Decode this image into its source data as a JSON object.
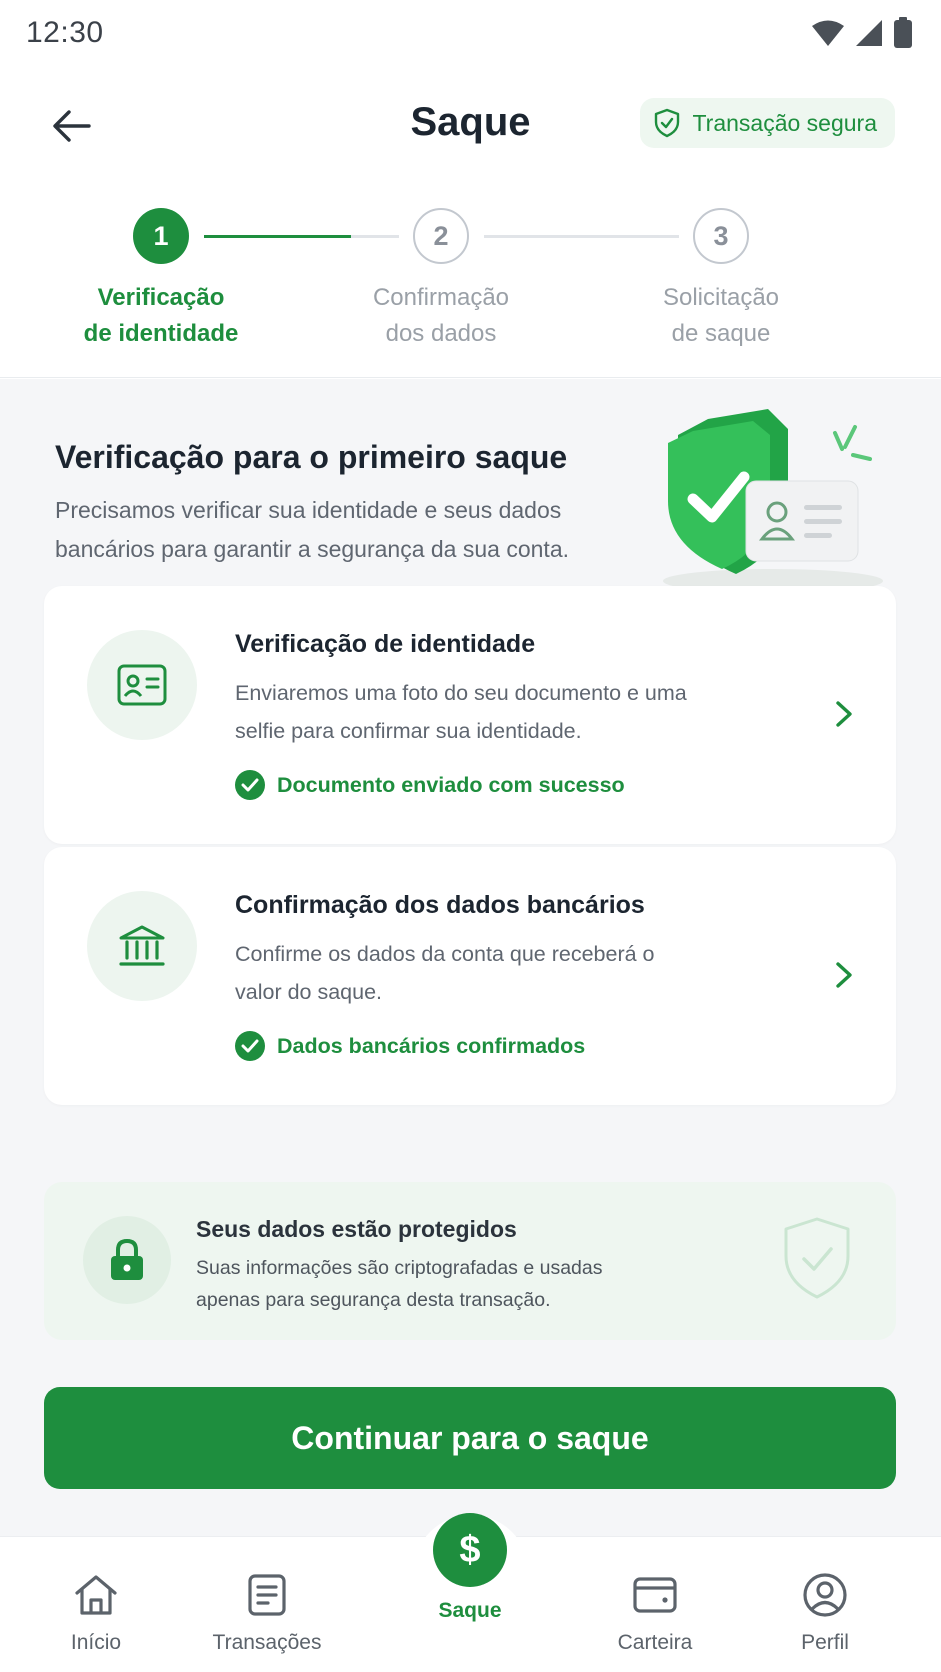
{
  "status_bar": {
    "time": "12:30"
  },
  "header": {
    "title": "Saque",
    "secure_badge": "Transação segura"
  },
  "stepper": {
    "steps": [
      {
        "number": "1",
        "label": "Verificação\nde identidade",
        "state": "active"
      },
      {
        "number": "2",
        "label": "Confirmação\ndos dados",
        "state": "pending"
      },
      {
        "number": "3",
        "label": "Solicitação\nde saque",
        "state": "pending"
      }
    ]
  },
  "intro": {
    "title": "Verificação para o primeiro saque",
    "description": "Precisamos verificar sua identidade e seus dados bancários para garantir a segurança da sua conta."
  },
  "cards": [
    {
      "icon": "id-card-icon",
      "title": "Verificação de identidade",
      "description": "Enviaremos uma foto do seu documento e uma selfie para confirmar sua identidade.",
      "status": "Documento enviado com sucesso"
    },
    {
      "icon": "bank-icon",
      "title": "Confirmação dos dados bancários",
      "description": "Confirme os dados da conta que receberá o valor do saque.",
      "status": "Dados bancários confirmados"
    }
  ],
  "protection": {
    "title": "Seus dados estão protegidos",
    "description": "Suas informações são criptografadas e usadas apenas para segurança desta transação."
  },
  "cta": {
    "label": "Continuar para o saque"
  },
  "bottom_nav": {
    "items": [
      {
        "label": "Início",
        "icon": "home-icon",
        "active": false
      },
      {
        "label": "Transações",
        "icon": "receipt-icon",
        "active": false
      },
      {
        "label": "Saque",
        "icon": "dollar-icon",
        "active": true
      },
      {
        "label": "Carteira",
        "icon": "wallet-icon",
        "active": false
      },
      {
        "label": "Perfil",
        "icon": "profile-icon",
        "active": false
      }
    ],
    "saque_symbol": "$"
  },
  "colors": {
    "accent": "#1e8e3e",
    "accent_soft": "#edf5ef",
    "background": "#f5f6f8",
    "text_primary": "#1c2530",
    "text_secondary": "#5f6670"
  }
}
